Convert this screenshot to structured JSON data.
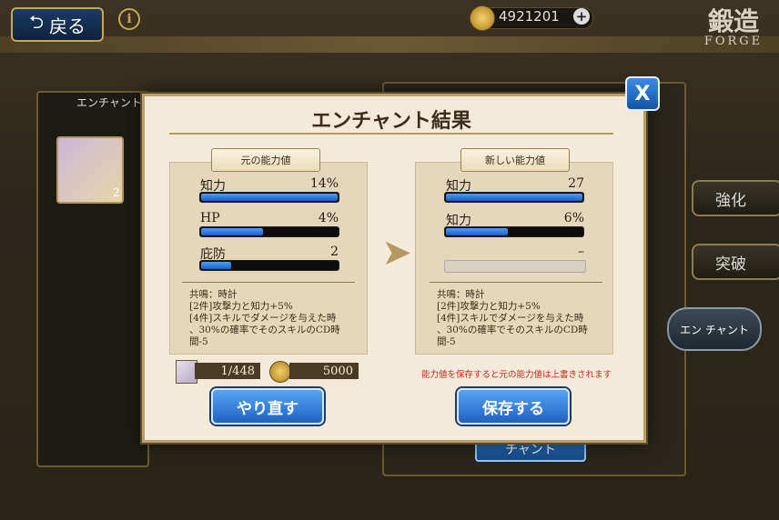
{
  "header": {
    "back_label": "戻る",
    "back_icon": "return-arrow-icon",
    "info_icon": "info-icon",
    "gold_amount": "4921201",
    "forge_title": "鍛造",
    "forge_subtitle": "FORGE"
  },
  "background": {
    "enchant_tab_label": "エンチャント",
    "item_count": "2",
    "side_buttons": [
      "強化",
      "突破"
    ],
    "enchant_side_label": "エン チャント",
    "bottom_button_label": "チャント"
  },
  "modal": {
    "title": "エンチャント結果",
    "close_label": "X",
    "old_panel": {
      "ribbon": "元の能力値",
      "stats": [
        {
          "label": "知力",
          "value": "14%",
          "fill": 1.0
        },
        {
          "label": "HP",
          "value": "4%",
          "fill": 0.45
        },
        {
          "label": "庇防",
          "value": "2",
          "fill": 0.22
        }
      ],
      "resonance": [
        "共鳴：時計",
        "[2件]攻撃力と知力+5%",
        "[4件]スキルでダメージを与えた時",
        "、30%の確率でそのスキルのCD時",
        "間-5"
      ]
    },
    "new_panel": {
      "ribbon": "新しい能力値",
      "stats": [
        {
          "label": "知力",
          "value": "27",
          "fill": 1.0
        },
        {
          "label": "知力",
          "value": "6%",
          "fill": 0.45
        },
        {
          "label": "",
          "value": "–",
          "fill": 0
        }
      ],
      "resonance": [
        "共鳴：時計",
        "[2件]攻撃力と知力+5%",
        "[4件]スキルでダメージを与えた時",
        "、30%の確率でそのスキルのCD時",
        "間-5"
      ]
    },
    "materials": {
      "scroll_count": "1/448",
      "gold_cost": "5000"
    },
    "warning": "能力値を保存すると元の能力値は上書きされます",
    "retry_label": "やり直す",
    "save_label": "保存する"
  }
}
